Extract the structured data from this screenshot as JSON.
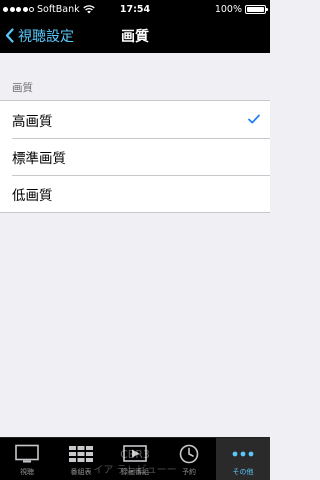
{
  "status_bar": {
    "carrier": "SoftBank",
    "time": "17:54",
    "battery_percent": "100%",
    "battery_level": 1.0
  },
  "nav": {
    "back_label": "視聴設定",
    "title": "画質"
  },
  "section": {
    "header": "画質",
    "options": [
      {
        "label": "高画質",
        "selected": true
      },
      {
        "label": "標準画質",
        "selected": false
      },
      {
        "label": "低画質",
        "selected": false
      }
    ]
  },
  "overlay": {
    "line1": "CBR3",
    "line2": "イア テレビューー"
  },
  "tab_bar": {
    "tabs": [
      {
        "label": "視聴",
        "icon": "tv-icon",
        "active": false
      },
      {
        "label": "番組表",
        "icon": "grid-icon",
        "active": false
      },
      {
        "label": "録画番組",
        "icon": "play-icon",
        "active": false
      },
      {
        "label": "予約",
        "icon": "clock-icon",
        "active": false
      },
      {
        "label": "その他",
        "icon": "more-icon",
        "active": true
      }
    ]
  },
  "colors": {
    "accent": "#5ac8fa",
    "checkmark": "#1a7cf5",
    "background": "#efeff4"
  }
}
